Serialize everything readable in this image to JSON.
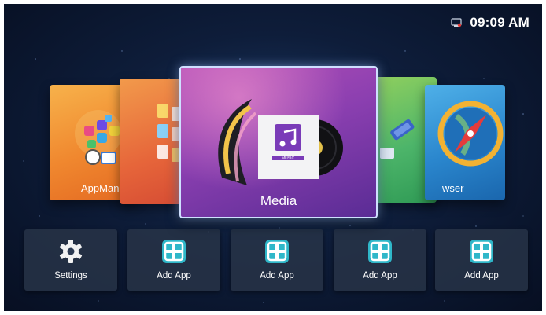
{
  "status": {
    "time": "09:09 AM",
    "network_icon": "ethernet-disconnected-icon",
    "network_alert_color": "#e53935"
  },
  "carousel": {
    "cards": [
      {
        "label": "AppMan",
        "icon": "app-manager-icon",
        "color": "#f0882f"
      },
      {
        "label": "",
        "icon": "gallery-icon",
        "color": "#e6653a"
      },
      {
        "label": "Media",
        "icon": "media-icon",
        "color": "#8b3fb0",
        "selected": true,
        "badge": "MUSIC"
      },
      {
        "label": "",
        "icon": "connect-icon",
        "color": "#4db56a"
      },
      {
        "label": "wser",
        "icon": "browser-compass-icon",
        "color": "#2a86cd"
      }
    ]
  },
  "shortcuts": [
    {
      "label": "Settings",
      "icon": "gear-icon"
    },
    {
      "label": "Add App",
      "icon": "add-app-icon"
    },
    {
      "label": "Add App",
      "icon": "add-app-icon"
    },
    {
      "label": "Add App",
      "icon": "add-app-icon"
    },
    {
      "label": "Add App",
      "icon": "add-app-icon"
    }
  ],
  "colors": {
    "accent": "#2fb7c9",
    "background": "#0e1d3a"
  }
}
